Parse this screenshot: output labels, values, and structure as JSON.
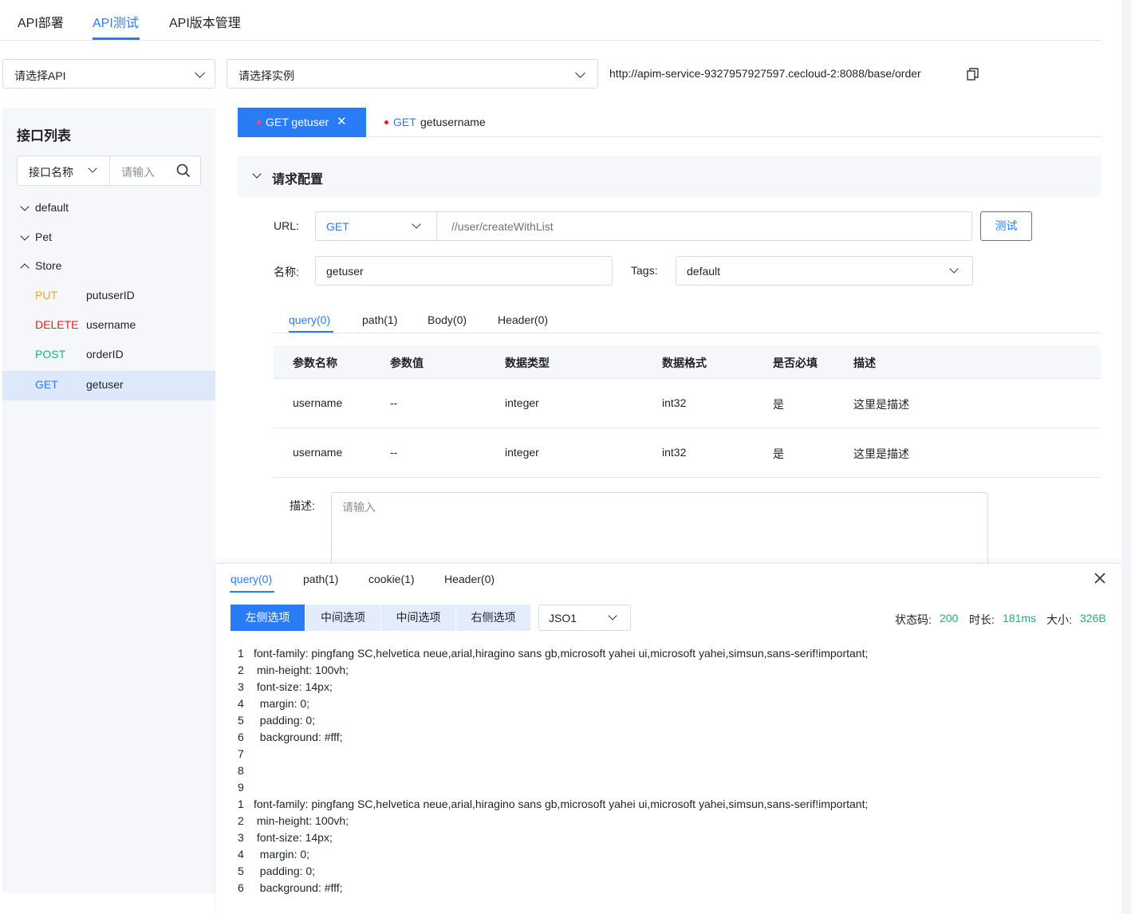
{
  "colors": {
    "primary": "#2a7cf6",
    "put": "#f5a623",
    "delete": "#e02020",
    "post": "#1db47a",
    "get": "#2a7cf6",
    "status_ok": "#1db47a"
  },
  "top_tabs": [
    {
      "label": "API部署",
      "active": false
    },
    {
      "label": "API测试",
      "active": true
    },
    {
      "label": "API版本管理",
      "active": false
    }
  ],
  "toolbar": {
    "api_select": "请选择API",
    "instance_select": "请选择实例",
    "base_url": "http://apim-service-9327957927597.cecloud-2:8088/base/order"
  },
  "sidebar": {
    "title": "接口列表",
    "search_type": "接口名称",
    "search_placeholder": "请输入",
    "groups": [
      {
        "label": "default",
        "expanded": false
      },
      {
        "label": "Pet",
        "expanded": false
      },
      {
        "label": "Store",
        "expanded": true
      }
    ],
    "items": [
      {
        "method": "PUT",
        "name": "putuserID"
      },
      {
        "method": "DELETE",
        "name": "username"
      },
      {
        "method": "POST",
        "name": "orderID"
      },
      {
        "method": "GET",
        "name": "getuser",
        "selected": true
      }
    ]
  },
  "request_tabs": [
    {
      "method": "GET",
      "name": "getuser",
      "label": "GET getuser",
      "close": "✕",
      "active": true
    },
    {
      "method": "GET",
      "name": "getusername",
      "active": false
    }
  ],
  "request_config": {
    "title": "请求配置",
    "url_label": "URL:",
    "method": "GET",
    "path": "//user/createWithList",
    "test_button": "测试",
    "name_label": "名称:",
    "name_value": "getuser",
    "tags_label": "Tags:",
    "tags_value": "default",
    "param_tabs": [
      "query(0)",
      "path(1)",
      "Body(0)",
      "Header(0)"
    ],
    "table": {
      "headers": [
        "参数名称",
        "参数值",
        "数据类型",
        "数据格式",
        "是否必填",
        "描述"
      ],
      "rows": [
        [
          "username",
          "--",
          "integer",
          "int32",
          "是",
          "这里是描述"
        ],
        [
          "username",
          "--",
          "integer",
          "int32",
          "是",
          "这里是描述"
        ]
      ]
    },
    "desc_label": "描述:",
    "desc_placeholder": "请输入"
  },
  "response": {
    "tabs": [
      "query(0)",
      "path(1)",
      "cookie(1)",
      "Header(0)"
    ],
    "segments": [
      "左侧选项",
      "中间选项",
      "中间选项",
      "右侧选项"
    ],
    "format": "JSO1",
    "status_label": "状态码:",
    "status_value": "200",
    "time_label": "时长:",
    "time_value": "181ms",
    "size_label": "大小:",
    "size_value": "326B",
    "code_lines": [
      {
        "n": "1",
        "t": "font-family: pingfang SC,helvetica neue,arial,hiragino sans gb,microsoft yahei ui,microsoft yahei,simsun,sans-serif!important;"
      },
      {
        "n": "2",
        "t": " min-height: 100vh;"
      },
      {
        "n": "3",
        "t": " font-size: 14px;"
      },
      {
        "n": "4",
        "t": "  margin: 0;"
      },
      {
        "n": "5",
        "t": "  padding: 0;"
      },
      {
        "n": "6",
        "t": "  background: #fff;"
      },
      {
        "n": "7",
        "t": ""
      },
      {
        "n": "8",
        "t": ""
      },
      {
        "n": "9",
        "t": ""
      },
      {
        "n": "1",
        "t": "font-family: pingfang SC,helvetica neue,arial,hiragino sans gb,microsoft yahei ui,microsoft yahei,simsun,sans-serif!important;"
      },
      {
        "n": "2",
        "t": " min-height: 100vh;"
      },
      {
        "n": "3",
        "t": " font-size: 14px;"
      },
      {
        "n": "4",
        "t": "  margin: 0;"
      },
      {
        "n": "5",
        "t": "  padding: 0;"
      },
      {
        "n": "6",
        "t": "  background: #fff;"
      }
    ]
  }
}
